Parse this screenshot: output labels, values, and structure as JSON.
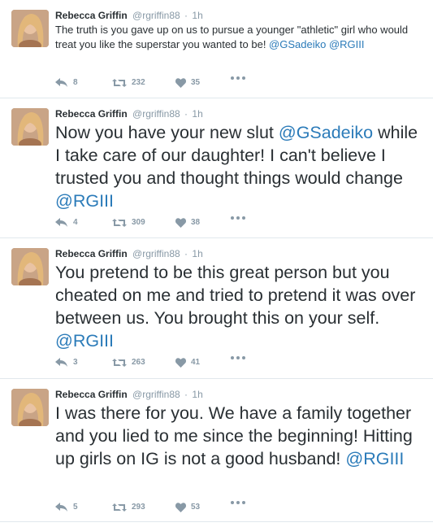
{
  "tweets": [
    {
      "name": "Rebecca Griffin",
      "handle": "@rgriffin88",
      "dot": "·",
      "time": "1h",
      "segments": [
        {
          "text": "The truth is you gave up on us to pursue a younger \"athletic\" girl who would treat you like the superstar you wanted to be! "
        },
        {
          "text": "@GSadeiko",
          "mention": true
        },
        {
          "text": " "
        },
        {
          "text": "@RGIII",
          "mention": true
        }
      ],
      "replies": "8",
      "retweets": "232",
      "likes": "35"
    },
    {
      "name": "Rebecca Griffin",
      "handle": "@rgriffin88",
      "dot": "·",
      "time": "1h",
      "segments": [
        {
          "text": "Now you have your new slut "
        },
        {
          "text": "@GSadeiko",
          "mention": true
        },
        {
          "text": " while I take care of our daughter! I can't believe I trusted you and thought things would change "
        },
        {
          "text": "@RGIII",
          "mention": true
        }
      ],
      "replies": "4",
      "retweets": "309",
      "likes": "38"
    },
    {
      "name": "Rebecca Griffin",
      "handle": "@rgriffin88",
      "dot": "·",
      "time": "1h",
      "segments": [
        {
          "text": "You pretend to be this great person but you cheated on me and tried to pretend it was over between us. You brought this on your self. "
        },
        {
          "text": "@RGIII",
          "mention": true
        }
      ],
      "replies": "3",
      "retweets": "263",
      "likes": "41"
    },
    {
      "name": "Rebecca Griffin",
      "handle": "@rgriffin88",
      "dot": "·",
      "time": "1h",
      "segments": [
        {
          "text": "I was there for you. We have a family together and you lied to me since the beginning! Hitting up girls on IG is not a good husband! "
        },
        {
          "text": "@RGIII",
          "mention": true
        }
      ],
      "replies": "5",
      "retweets": "293",
      "likes": "53"
    }
  ],
  "icons": {
    "reply": "reply-icon",
    "retweet": "retweet-icon",
    "like": "heart-icon",
    "more": "more-dots-icon"
  },
  "colors": {
    "mention": "#2b7bb9",
    "muted": "#8899a6",
    "text": "#292f33",
    "divider": "#e1e8ed"
  }
}
